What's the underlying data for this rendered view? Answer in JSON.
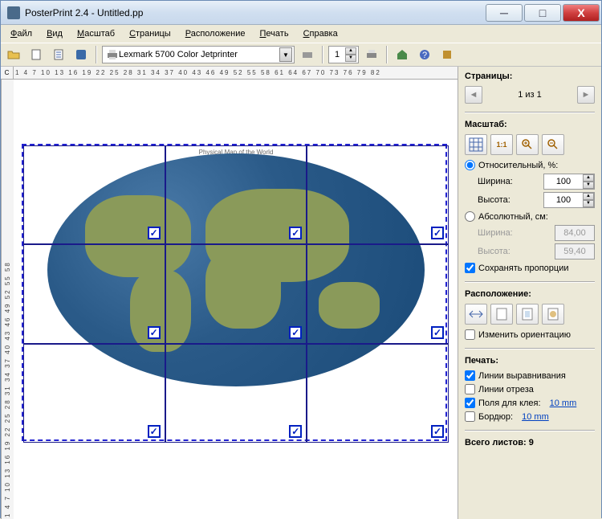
{
  "window": {
    "title": "PosterPrint 2.4 - Untitled.pp"
  },
  "menu": {
    "file": "Файл",
    "view": "Вид",
    "scale": "Масштаб",
    "pages": "Страницы",
    "layout": "Расположение",
    "print": "Печать",
    "help": "Справка"
  },
  "toolbar": {
    "printer": "Lexmark 5700 Color Jetprinter",
    "copies": "1"
  },
  "ruler": {
    "corner": "C",
    "h": "1 4 7 10 13 16 19 22 25 28 31 34 37 40 43 46 49 52 55 58 61 64 67 70 73 76 79 82",
    "v": "1 4 7 10 13 16 19 22 25 28 31 34 37 40 43 46 49 52 55 58"
  },
  "map": {
    "title": "Physical Map of the World"
  },
  "sidebar": {
    "pages": {
      "header": "Страницы:",
      "nav": "1 из 1"
    },
    "scale": {
      "header": "Масштаб:",
      "relative": "Относительный, %:",
      "width": "Ширина:",
      "height": "Высота:",
      "width_val": "100",
      "height_val": "100",
      "absolute": "Абсолютный, см:",
      "abs_w": "84,00",
      "abs_h": "59,40",
      "keep": "Сохранять пропорции"
    },
    "layout": {
      "header": "Расположение:",
      "rotate": "Изменить ориентацию"
    },
    "print": {
      "header": "Печать:",
      "align": "Линии выравнивания",
      "cut": "Линии отреза",
      "glue": "Поля для клея:",
      "glue_val": "10 mm",
      "border": "Бордюр:",
      "border_val": "10 mm"
    },
    "total": {
      "label": "Всего листов:",
      "value": "9"
    }
  }
}
